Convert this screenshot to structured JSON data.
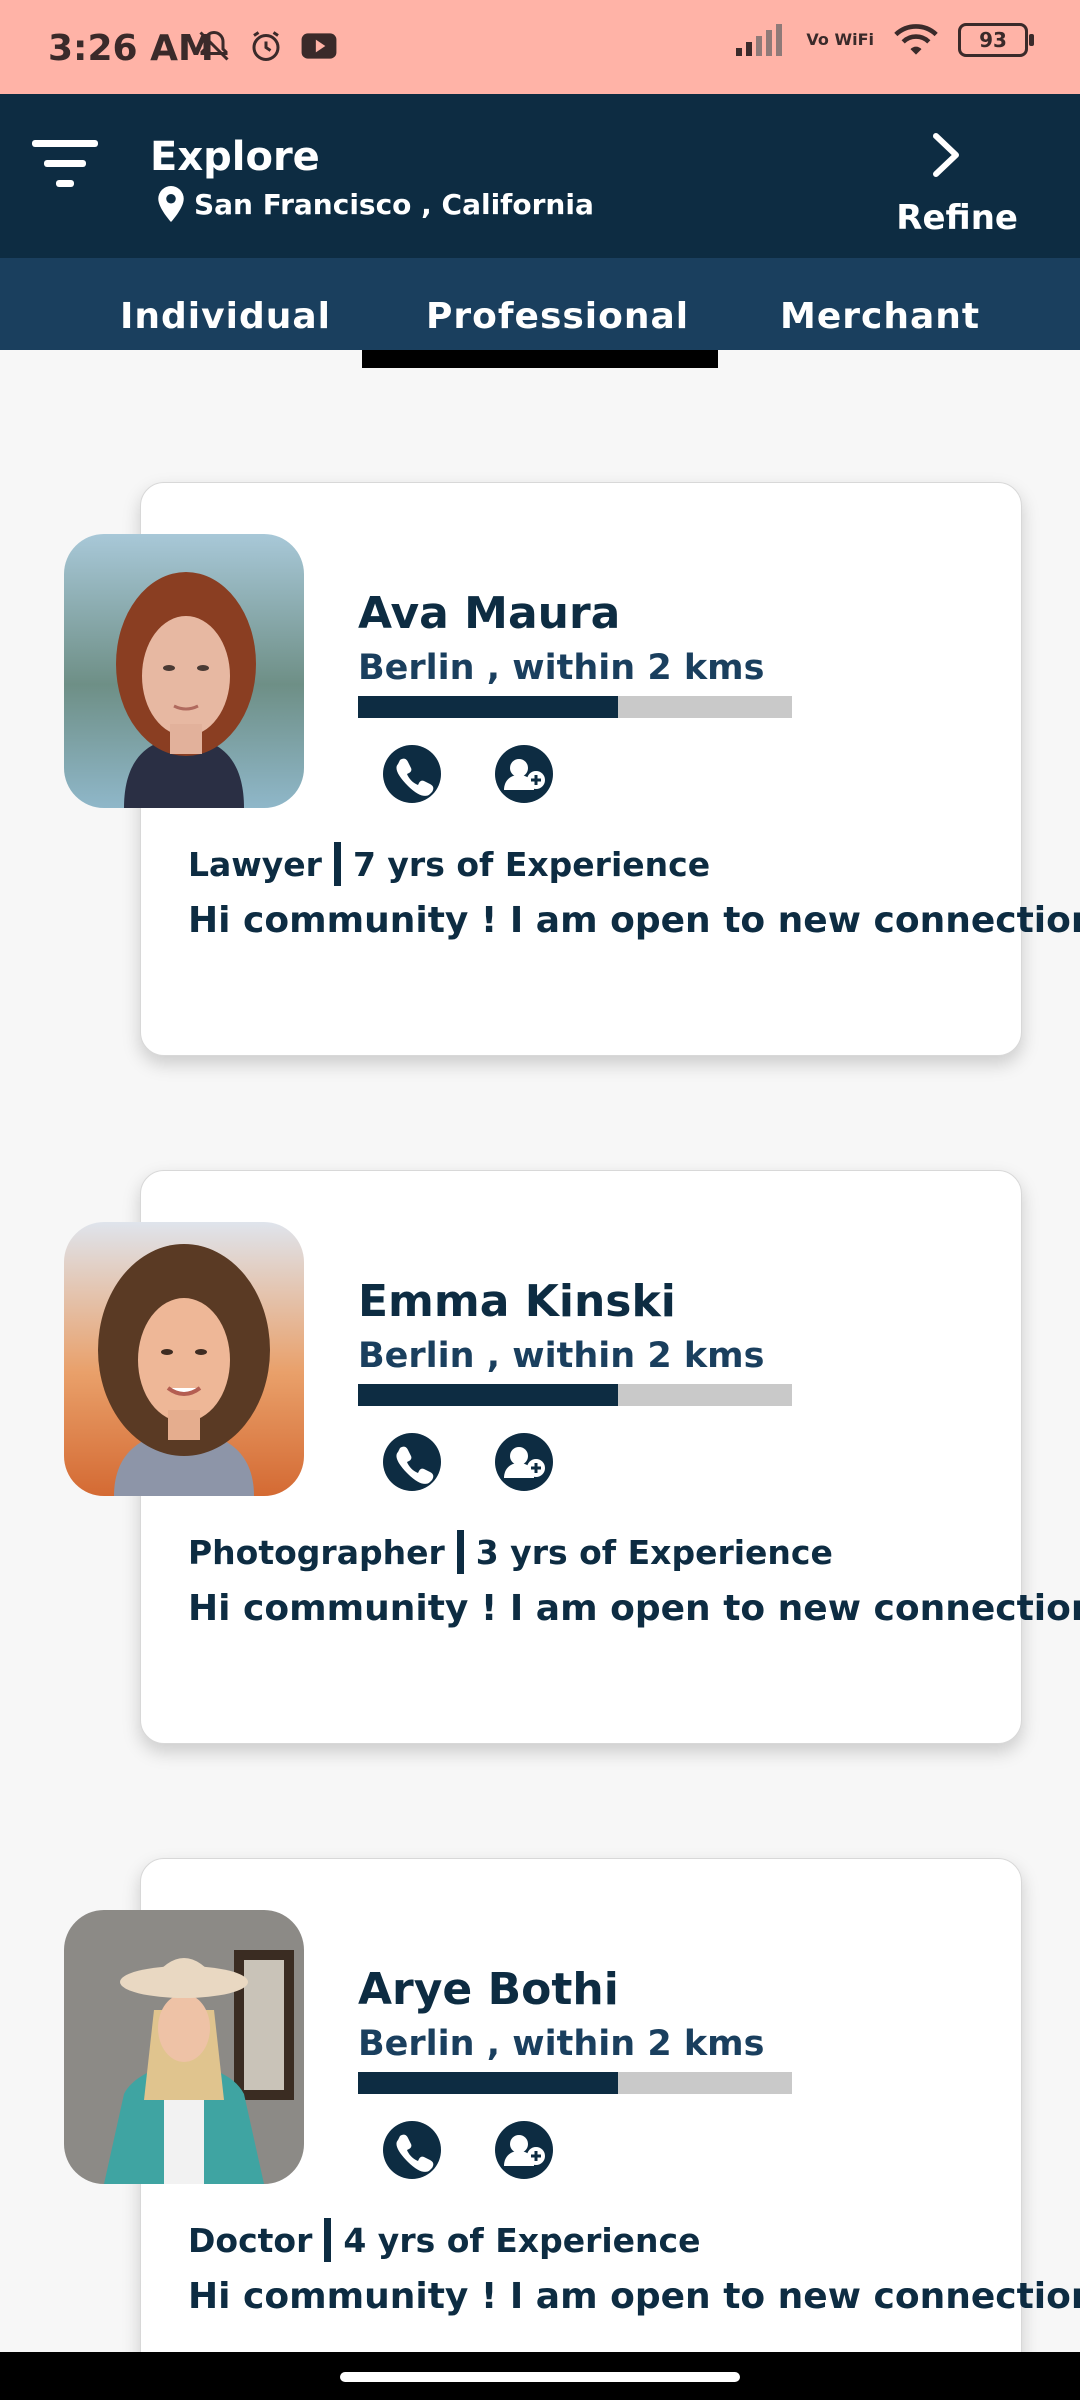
{
  "status_bar": {
    "time": "3:26 AM",
    "wifi_label": "Vo WiFi",
    "battery": "93"
  },
  "header": {
    "title": "Explore",
    "location": "San Francisco , California",
    "refine_label": "Refine"
  },
  "tabs": [
    {
      "label": "Individual"
    },
    {
      "label": "Professional"
    },
    {
      "label": "Merchant"
    }
  ],
  "active_tab": "Professional",
  "profiles": [
    {
      "name": "Ava Maura",
      "distance": "Berlin , within 2 kms",
      "proximity": 0.6,
      "profession": "Lawyer",
      "experience": "7 yrs of Experience",
      "bio": "Hi community ! I am open to new connections"
    },
    {
      "name": "Emma Kinski",
      "distance": "Berlin , within 2 kms",
      "proximity": 0.6,
      "profession": "Photographer",
      "experience": "3 yrs of Experience",
      "bio": "Hi community ! I am open to new connections"
    },
    {
      "name": "Arye Bothi",
      "distance": "Berlin , within 2 kms",
      "proximity": 0.6,
      "profession": "Doctor",
      "experience": "4 yrs of Experience",
      "bio": "Hi community ! I am open to new connections"
    }
  ],
  "colors": {
    "status_bar": "#ffb3a7",
    "header": "#0d2c42",
    "tabs": "#1a3f5e",
    "accent": "#0d2c42",
    "progress_track": "#c9c9c9"
  },
  "icons": [
    "muted-bell-icon",
    "alarm-icon",
    "youtube-icon",
    "signal-icon",
    "wifi-icon",
    "battery-icon",
    "menu-icon",
    "location-pin-icon",
    "chevron-right-icon",
    "phone-icon",
    "add-user-icon"
  ]
}
